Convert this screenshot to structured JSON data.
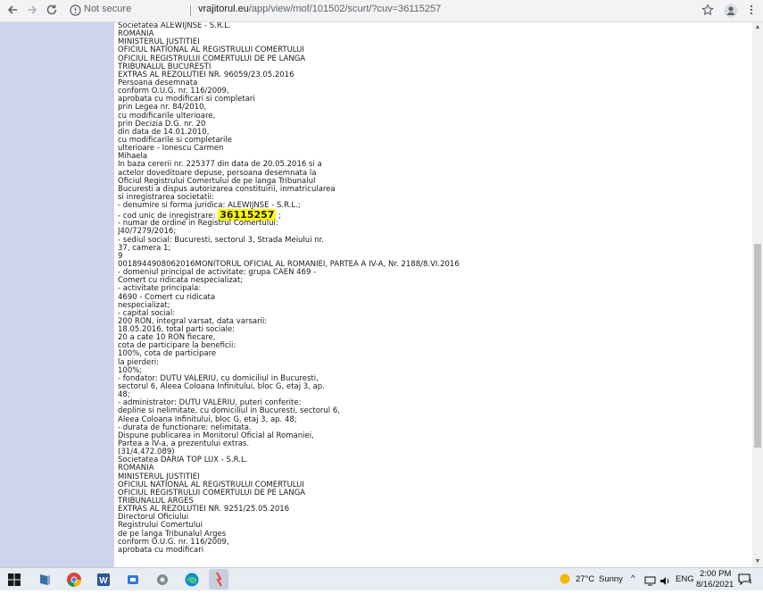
{
  "browser": {
    "not_secure": "Not secure",
    "url_host": "vrajitorul.eu",
    "url_path": "/app/view/mof/101502/scurt/?cuv=36115257"
  },
  "document": {
    "lines": [
      "Societatea ALEWIJNSE - S.R.L.",
      "ROMANIA",
      "MINISTERUL JUSTITIEI",
      "OFICIUL NATIONAL AL REGISTRULUI COMERTULUI",
      "OFICIUL REGISTRULUI COMERTULUI DE PE LANGA",
      "TRIBUNALUL BUCURESTI",
      "EXTRAS AL REZOLUTIEI NR. 96059/23.05.2016",
      "Persoana desemnata",
      "conform O.U.G. nr. 116/2009,",
      "aprobata cu modificari si completari",
      "prin Legea nr. 84/2010,",
      "cu modificarile ulterioare,",
      "prin Decizia D.G. nr. 20",
      "din data de 14.01.2010,",
      "cu modificarile si completarile",
      "ulterioare - Ionescu Carmen",
      "Mihaela",
      "In baza cererii nr. 225377 din data de 20.05.2016 si a",
      "actelor doveditoare depuse, persoana desemnata la",
      "Oficiul Registrului Comertului de pe langa Tribunalul",
      "Bucuresti a dispus autorizarea constituirii, inmatricularea",
      "si inregistrarea societatii:",
      "- denumire si forma juridica: ALEWIJNSE - S.R.L.;",
      "",
      "- numar de ordine in Registrul Comertului:",
      "J40/7279/2016;",
      "- sediul social: Bucuresti, sectorul 3, Strada Meiului nr.",
      "37, camera 1;",
      "9",
      "0018944908062016MONITORUL OFICIAL AL ROMANIEI, PARTEA A IV-A, Nr. 2188/8.VI.2016",
      "- domeniul principal de activitate: grupa CAEN 469 -",
      "Comert cu ridicata nespecializat;",
      "- activitate principala:",
      "4690 - Comert cu ridicata",
      "nespecializat;",
      "- capital social:",
      "200 RON, integral varsat, data varsarii:",
      "18.05.2016, total parti sociale:",
      "20 a cate 10 RON fiecare,",
      "cota de participare la beneficii:",
      "100%, cota de participare",
      "la pierderi:",
      "100%;",
      "- fondator: DUTU VALERIU, cu domiciliul in Bucuresti,",
      "sectorul 6, Aleea Coloana Infinitului, bloc G, etaj 3, ap.",
      "48;",
      "- administrator: DUTU VALERIU, puteri conferite:",
      "depline si nelimitate, cu domiciliul in Bucuresti, sectorul 6,",
      "Aleea Coloana Infinitului, bloc G, etaj 3, ap. 48;",
      "- durata de functionare: nelimitata.",
      "Dispune publicarea in Monitorul Oficial al Romaniei,",
      "Partea a IV-a, a prezentului extras.",
      "(31/4.472.089)",
      "Societatea DARIA TOP LUX - S.R.L.",
      "ROMANIA",
      "MINISTERUL JUSTITIEI",
      "OFICIUL NATIONAL AL REGISTRULUI COMERTULUI",
      "OFICIUL REGISTRULUI COMERTULUI DE PE LANGA",
      "TRIBUNALUL ARGES",
      "EXTRAS AL REZOLUTIEI NR. 9251/25.05.2016",
      "Directorul Oficiului",
      "Registrului Comertului",
      "de pe langa Tribunalul Arges",
      "conform O.U.G. nr. 116/2009,",
      "aprobata cu modificari"
    ],
    "cui_prefix": "- cod unic de inregistrare: ",
    "cui_value": "36115257",
    "cui_suffix": " ;"
  },
  "taskbar": {
    "weather_temp": "27°C",
    "weather_desc": "Sunny",
    "lang": "ENG",
    "time": "2:00 PM",
    "date": "8/16/2021",
    "notif_count": "1"
  }
}
